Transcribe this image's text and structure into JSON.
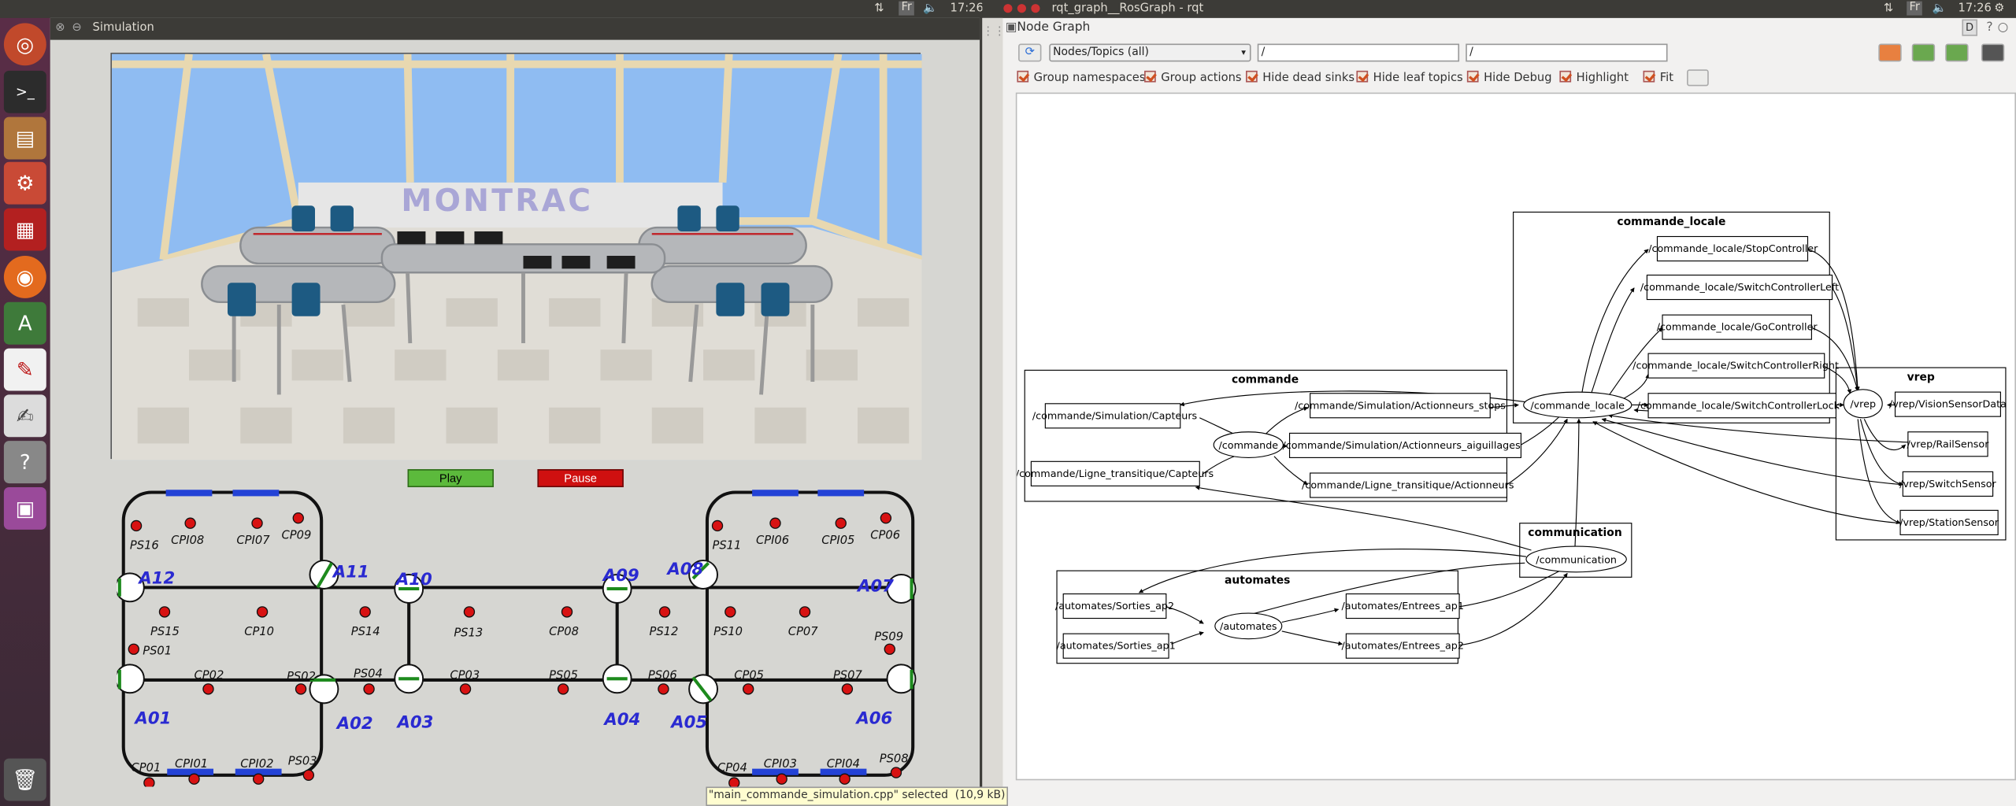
{
  "top_panel_left": {
    "time": "17:26",
    "keyboard": "Fr",
    "window_title": "rqt_graph__RosGraph - rqt"
  },
  "top_panel_right": {
    "time": "17:26",
    "keyboard": "Fr"
  },
  "launcher": {
    "icons": [
      "ubuntu-dash-icon",
      "terminal-icon",
      "files-icon",
      "settings-icon",
      "vrep-icon",
      "firefox-icon",
      "software-center-icon",
      "pdf-reader-icon",
      "text-editor-icon",
      "help-icon",
      "workspaces-icon",
      "trash-icon"
    ]
  },
  "sim_window": {
    "title": "Simulation",
    "brand": "MONTRAC",
    "play_label": "Play",
    "pause_label": "Pause"
  },
  "track_map": {
    "switches": [
      "A01",
      "A02",
      "A03",
      "A04",
      "A05",
      "A06",
      "A07",
      "A08",
      "A09",
      "A10",
      "A11",
      "A12"
    ],
    "sensors": [
      "PS16",
      "CPI08",
      "CPI07",
      "CP09",
      "PS15",
      "CP10",
      "PS14",
      "PS13",
      "CP08",
      "PS12",
      "PS11",
      "CPI06",
      "CPI05",
      "CP06",
      "PS10",
      "CP07",
      "PS09",
      "PS01",
      "CP02",
      "PS02",
      "PS04",
      "CP03",
      "PS05",
      "PS06",
      "CP05",
      "PS07",
      "CP01",
      "CPI01",
      "CPI02",
      "PS03",
      "CP04",
      "CPI03",
      "CPI04",
      "PS08"
    ]
  },
  "rqt": {
    "plugin_title": "Node Graph",
    "plugin_buttons": "D",
    "mode_combo": "Nodes/Topics (all)",
    "filter1": "/",
    "filter2": "/",
    "options": {
      "group_namespaces": "Group namespaces",
      "group_actions": "Group actions",
      "hide_dead_sinks": "Hide dead sinks",
      "hide_leaf_topics": "Hide leaf topics",
      "hide_debug": "Hide Debug",
      "highlight": "Highlight",
      "fit": "Fit"
    },
    "graph": {
      "clusters": {
        "commande_locale": "commande_locale",
        "commande": "commande",
        "vrep": "vrep",
        "communication": "communication",
        "automates": "automates"
      },
      "nodes": {
        "commande_locale": "/commande_locale",
        "commande": "/commande",
        "vrep": "/vrep",
        "communication": "/communication",
        "automates": "/automates"
      },
      "topics": {
        "stop": "/commande_locale/StopController",
        "swleft": "/commande_locale/SwitchControllerLeft",
        "go": "/commande_locale/GoController",
        "swright": "/commande_locale/SwitchControllerRight",
        "swlock": "/commande_locale/SwitchControllerLock",
        "simcap": "/commande/Simulation/Capteurs",
        "ligcap": "/commande/Ligne_transitique/Capteurs",
        "simstops": "/commande/Simulation/Actionneurs_stops",
        "simaig": "/commande/Simulation/Actionneurs_aiguillages",
        "ligact": "/commande/Ligne_transitique/Actionneurs",
        "vision": "/vrep/VisionSensorData",
        "rail": "/vrep/RailSensor",
        "switchs": "/vrep/SwitchSensor",
        "station": "/vrep/StationSensor",
        "sortiesap2": "/automates/Sorties_ap2",
        "sortiesap1": "/automates/Sorties_ap1",
        "entreesap1": "/automates/Entrees_ap1",
        "entreesap2": "/automates/Entrees_ap2"
      }
    }
  },
  "status_tooltip": "\"main_commande_simulation.cpp\" selected  (10,9 kB)"
}
